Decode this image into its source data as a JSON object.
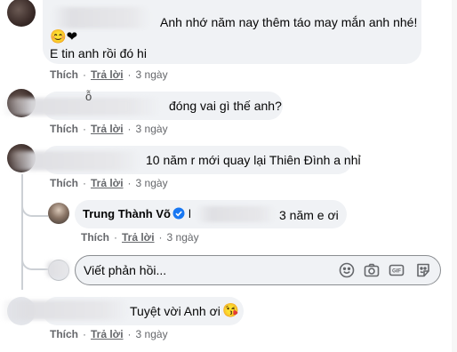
{
  "comments": [
    {
      "text": "Anh nhớ năm nay thêm táo may mắn anh nhé!",
      "text2": "E tin anh rồi đó hi",
      "emoji": "😊❤",
      "like": "Thích",
      "reply": "Trả lời",
      "time": "3 ngày"
    },
    {
      "name_fragment": "ỗ",
      "text": "đóng vai gì thế anh?",
      "like": "Thích",
      "reply": "Trả lời",
      "time": "3 ngày"
    },
    {
      "text": "10 năm r mới quay lại Thiên Đình a nhỉ",
      "like": "Thích",
      "reply": "Trả lời",
      "time": "3 ngày"
    },
    {
      "text": "Tuyệt vời Anh ơi",
      "emoji": "😘",
      "like": "Thích",
      "reply": "Trả lời",
      "time": "3 ngày"
    }
  ],
  "reply": {
    "author": "Trung Thành Võ",
    "prefix": "l",
    "text": "3 năm e ơi",
    "like": "Thích",
    "reply": "Trả lời",
    "time": "3 ngày"
  },
  "composer": {
    "placeholder": "Viết phản hồi...",
    "icons": [
      "emoji-icon",
      "camera-icon",
      "gif-icon",
      "sticker-icon"
    ]
  },
  "colors": {
    "bubble": "#f0f2f5",
    "meta": "#65676b",
    "verified": "#1877f2"
  }
}
